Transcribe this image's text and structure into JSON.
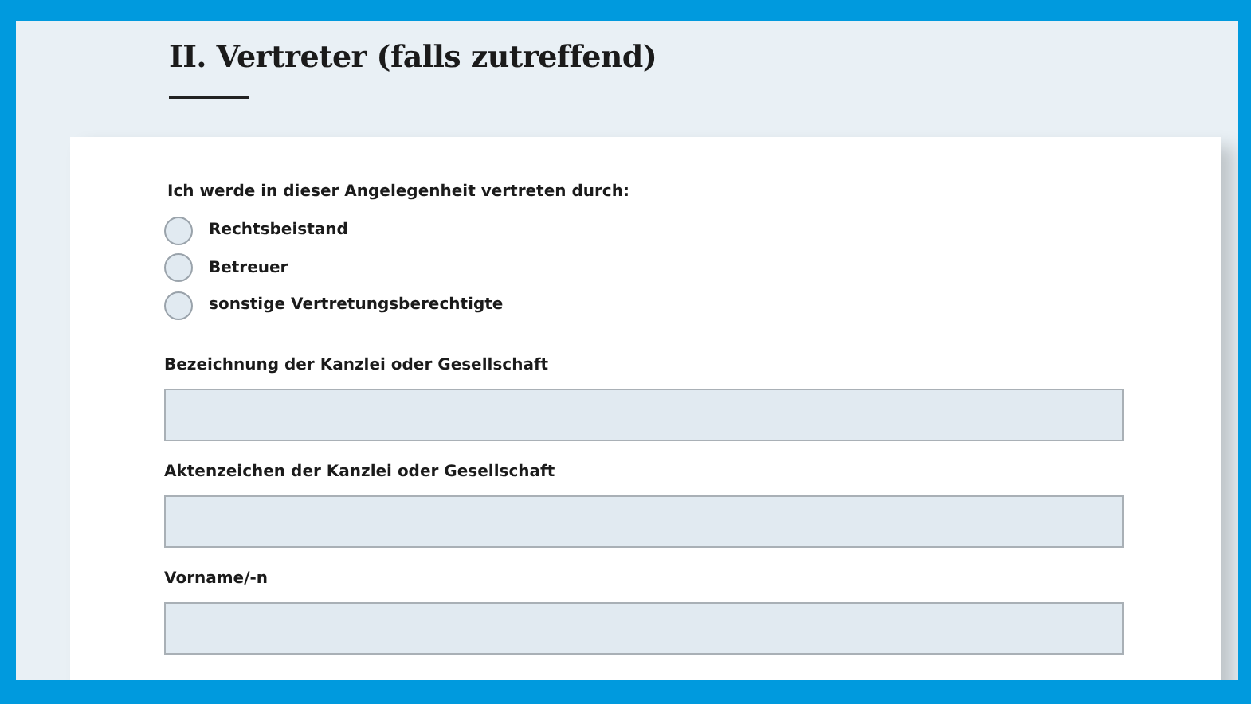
{
  "section": {
    "title": "II. Vertreter (falls zutreffend)"
  },
  "representation": {
    "question": "Ich werde in dieser Angelegenheit vertreten durch:",
    "options": [
      {
        "label": "Rechtsbeistand",
        "selected": false
      },
      {
        "label": "Betreuer",
        "selected": false
      },
      {
        "label": "sonstige Vertretungsberechtigte",
        "selected": false
      }
    ]
  },
  "fields": [
    {
      "label": "Bezeichnung der Kanzlei oder Gesellschaft"
    },
    {
      "label": "Aktenzeichen der Kanzlei oder Gesellschaft"
    },
    {
      "label": "Vorname/-n"
    }
  ]
}
